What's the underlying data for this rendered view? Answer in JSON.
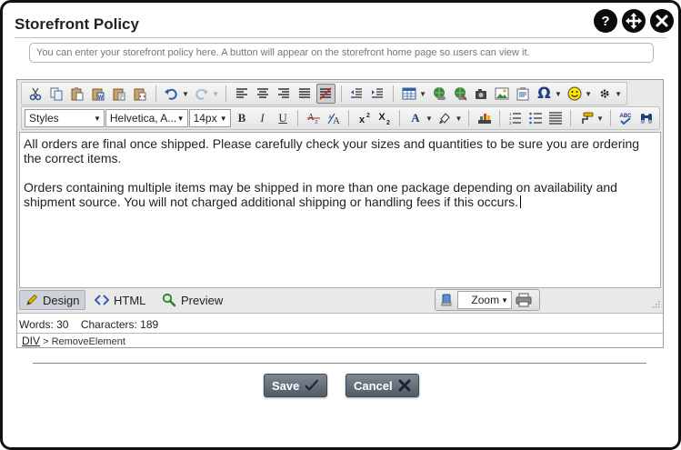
{
  "dialog": {
    "title": "Storefront Policy",
    "icons": [
      "help-icon",
      "move-icon",
      "close-icon"
    ]
  },
  "hint": {
    "placeholder": "You can enter your storefront policy here. A button will appear on the storefront home page so users can view it."
  },
  "toolbar": {
    "styles_label": "Styles",
    "font_label": "Helvetica, A...",
    "size_label": "14px",
    "bold": "B",
    "italic": "I",
    "underline": "U",
    "omega": "Ω"
  },
  "content": {
    "paragraphs": [
      "All orders are final once shipped. Please carefully check your sizes and quantities to be sure you are ordering the correct items.",
      "Orders containing multiple items may be shipped in more than one package depending on availability and shipment source. You will not charged additional shipping or handling fees if this occurs."
    ]
  },
  "modes": {
    "design": "Design",
    "html": "HTML",
    "preview": "Preview",
    "active": "Design"
  },
  "zoom": {
    "label": "Zoom"
  },
  "status": {
    "words": "Words: 30",
    "characters": "Characters: 189"
  },
  "path": {
    "tag": "DIV",
    "separator": ">",
    "action": "RemoveElement"
  },
  "buttons": {
    "save": "Save",
    "cancel": "Cancel"
  },
  "colors": {
    "button_top": "#7e8894",
    "button_bottom": "#525c66",
    "title_icon_bg": "#0b0b0b",
    "active_tab_bg": "#cdd2d8"
  }
}
